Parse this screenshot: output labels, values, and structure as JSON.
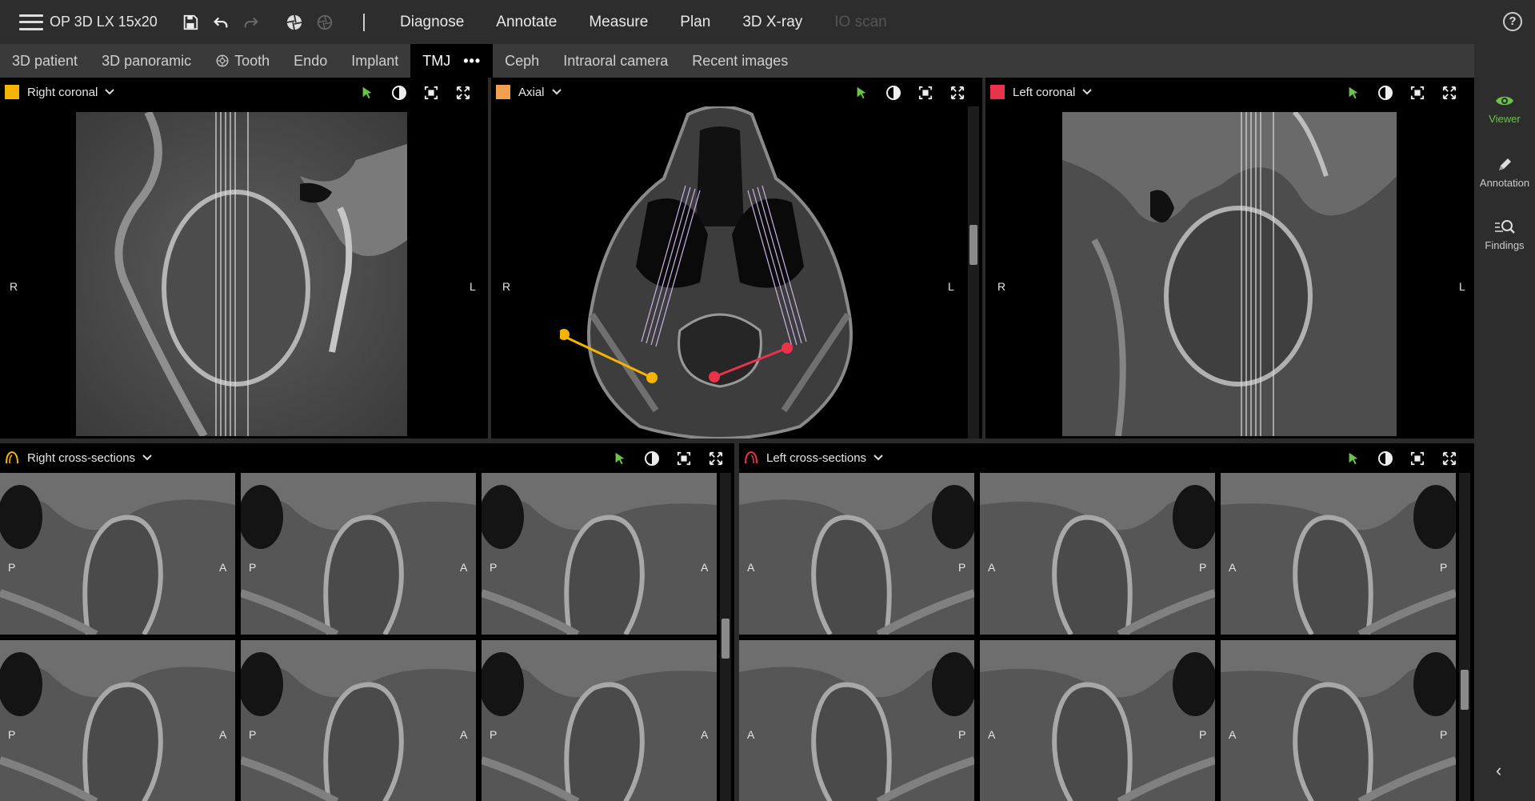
{
  "app": {
    "device_name": "OP 3D LX 15x20"
  },
  "top_menu": [
    {
      "label": "Diagnose",
      "enabled": true
    },
    {
      "label": "Annotate",
      "enabled": true
    },
    {
      "label": "Measure",
      "enabled": true
    },
    {
      "label": "Plan",
      "enabled": true
    },
    {
      "label": "3D X-ray",
      "enabled": true
    },
    {
      "label": "IO scan",
      "enabled": false
    }
  ],
  "toolbar_icons": [
    "save-icon",
    "undo-icon",
    "redo-icon",
    "aperture-icon",
    "aperture-disabled-icon"
  ],
  "help_label": "?",
  "tabs": [
    {
      "label": "3D patient"
    },
    {
      "label": "3D panoramic"
    },
    {
      "label": "Tooth"
    },
    {
      "label": "Endo"
    },
    {
      "label": "Implant"
    },
    {
      "label": "TMJ",
      "active": true,
      "more": "•••"
    },
    {
      "label": "Ceph"
    },
    {
      "label": "Intraoral camera"
    },
    {
      "label": "Recent images"
    }
  ],
  "sidebar": [
    {
      "label": "Viewer",
      "icon": "eye-icon",
      "active": true
    },
    {
      "label": "Annotation",
      "icon": "pencil-icon",
      "active": false
    },
    {
      "label": "Findings",
      "icon": "findings-search-icon",
      "active": false
    }
  ],
  "collapse_label": "‹",
  "colors": {
    "accent_green": "#6cc24a",
    "right_coronal": "#f5b400",
    "axial": "#f0a050",
    "left_coronal": "#e8334a",
    "right_cross": "#f5b400",
    "left_cross": "#e8334a"
  },
  "views": {
    "right_coronal": {
      "title": "Right coronal",
      "left": "R",
      "right": "L"
    },
    "axial": {
      "title": "Axial",
      "left": "R",
      "right": "L"
    },
    "left_coronal": {
      "title": "Left coronal",
      "left": "R",
      "right": "L"
    },
    "right_cross": {
      "title": "Right cross-sections",
      "left": "P",
      "right": "A"
    },
    "left_cross": {
      "title": "Left cross-sections",
      "left": "A",
      "right": "P"
    }
  }
}
